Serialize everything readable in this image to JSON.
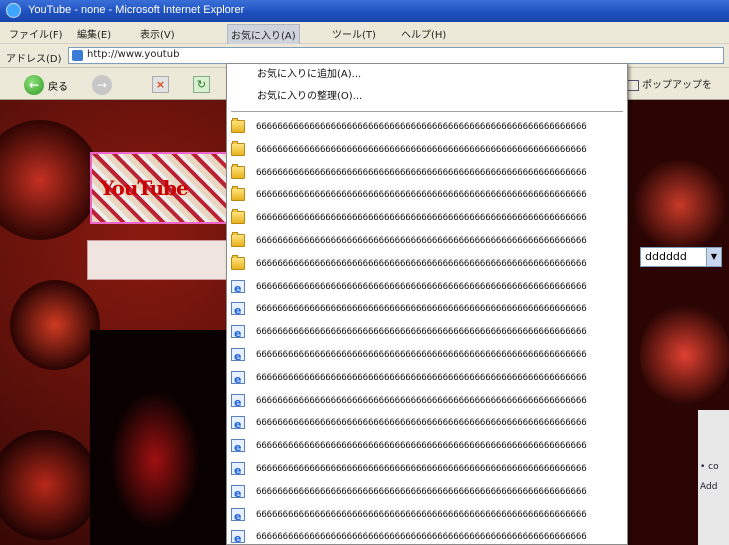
{
  "window": {
    "title": "YouTube - none - Microsoft Internet Explorer"
  },
  "menubar": {
    "items": [
      {
        "label": "ファイル(F)"
      },
      {
        "label": "編集(E)"
      },
      {
        "label": "表示(V)"
      },
      {
        "label": "お気に入り(A)"
      },
      {
        "label": "ツール(T)"
      },
      {
        "label": "ヘルプ(H)"
      }
    ]
  },
  "address": {
    "label": "アドレス(D)",
    "url": "http://www.youtub"
  },
  "toolbar": {
    "back_label": "戻る",
    "popup_label": "ポップアップを"
  },
  "page": {
    "dropdown_value": "dddddd"
  },
  "favorites_menu": {
    "add_label": "お気に入りに追加(A)...",
    "organize_label": "お気に入りの整理(O)...",
    "items": [
      {
        "icon": "folder-icon",
        "label": "66666666666666666666666666666666666666666666666666666666666666"
      },
      {
        "icon": "folder-icon",
        "label": "66666666666666666666666666666666666666666666666666666666666666"
      },
      {
        "icon": "folder-icon",
        "label": "66666666666666666666666666666666666666666666666666666666666666"
      },
      {
        "icon": "folder-icon",
        "label": "66666666666666666666666666666666666666666666666666666666666666"
      },
      {
        "icon": "folder-icon",
        "label": "66666666666666666666666666666666666666666666666666666666666666"
      },
      {
        "icon": "folder-icon",
        "label": "66666666666666666666666666666666666666666666666666666666666666"
      },
      {
        "icon": "folder-icon",
        "label": "66666666666666666666666666666666666666666666666666666666666666"
      },
      {
        "icon": "page-icon",
        "label": "66666666666666666666666666666666666666666666666666666666666666"
      },
      {
        "icon": "page-icon",
        "label": "66666666666666666666666666666666666666666666666666666666666666"
      },
      {
        "icon": "page-icon",
        "label": "66666666666666666666666666666666666666666666666666666666666666"
      },
      {
        "icon": "page-icon",
        "label": "66666666666666666666666666666666666666666666666666666666666666"
      },
      {
        "icon": "page-icon",
        "label": "66666666666666666666666666666666666666666666666666666666666666"
      },
      {
        "icon": "page-icon",
        "label": "66666666666666666666666666666666666666666666666666666666666666"
      },
      {
        "icon": "page-icon",
        "label": "66666666666666666666666666666666666666666666666666666666666666"
      },
      {
        "icon": "page-icon",
        "label": "66666666666666666666666666666666666666666666666666666666666666"
      },
      {
        "icon": "page-icon",
        "label": "66666666666666666666666666666666666666666666666666666666666666"
      },
      {
        "icon": "page-icon",
        "label": "66666666666666666666666666666666666666666666666666666666666666"
      },
      {
        "icon": "page-icon",
        "label": "66666666666666666666666666666666666666666666666666666666666666"
      },
      {
        "icon": "page-icon",
        "label": "66666666666666666666666666666666666666666666666666666666666666"
      },
      {
        "icon": "page-icon",
        "label": "66666666666666666666666666666666666666666666666666666666666666"
      }
    ]
  },
  "right_panel": {
    "line1": "• co",
    "line2": "Add"
  }
}
